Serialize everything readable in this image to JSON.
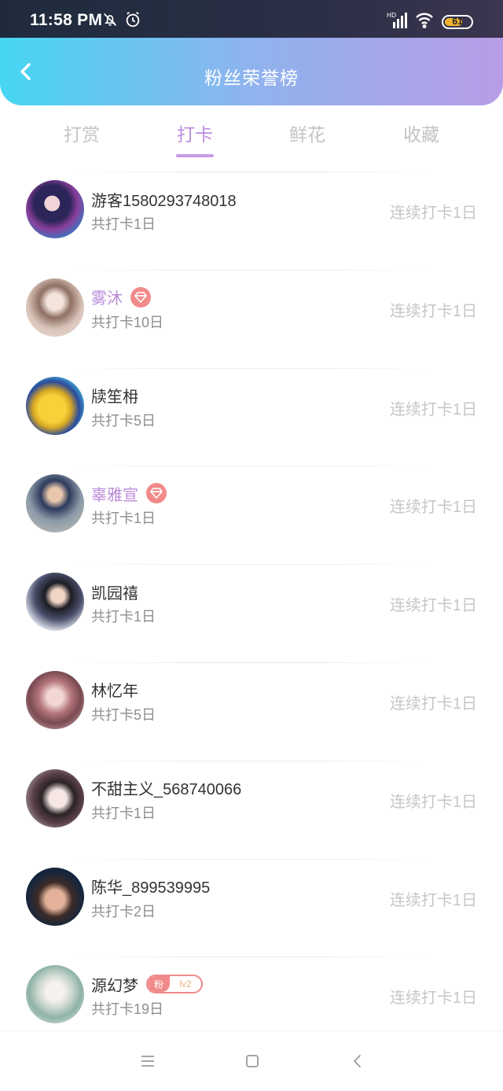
{
  "status_bar": {
    "time": "11:58 PM",
    "battery": "61",
    "icons": [
      "bell-off-icon",
      "alarm-icon",
      "signal-icon",
      "wifi-icon",
      "battery-icon"
    ]
  },
  "header": {
    "title": "粉丝荣誉榜",
    "back_icon": "chevron-left-icon"
  },
  "tabs": [
    {
      "label": "打赏",
      "active": false
    },
    {
      "label": "打卡",
      "active": true
    },
    {
      "label": "鲜花",
      "active": false
    },
    {
      "label": "收藏",
      "active": false
    }
  ],
  "colors": {
    "header_start": "#46d6f3",
    "header_end": "#b89ce6",
    "active_tab": "#bd8ce0",
    "vip_name": "#b98ad8",
    "badge": "#f28a8a"
  },
  "users": [
    {
      "name": "游客1580293748018",
      "total": "共打卡1日",
      "streak": "连续打卡1日",
      "vip": false
    },
    {
      "name": "雾沐",
      "total": "共打卡10日",
      "streak": "连续打卡1日",
      "vip": true
    },
    {
      "name": "牍笙枏",
      "total": "共打卡5日",
      "streak": "连续打卡1日",
      "vip": false
    },
    {
      "name": "辜雅宣",
      "total": "共打卡1日",
      "streak": "连续打卡1日",
      "vip": true
    },
    {
      "name": "凯园禧",
      "total": "共打卡1日",
      "streak": "连续打卡1日",
      "vip": false
    },
    {
      "name": "林忆年",
      "total": "共打卡5日",
      "streak": "连续打卡1日",
      "vip": false
    },
    {
      "name": "不甜主义_568740066",
      "total": "共打卡1日",
      "streak": "连续打卡1日",
      "vip": false
    },
    {
      "name": "陈华_899539995",
      "total": "共打卡2日",
      "streak": "连续打卡1日",
      "vip": false
    },
    {
      "name": "源幻梦",
      "total": "共打卡19日",
      "streak": "连续打卡1日",
      "vip": false,
      "fan_badge": {
        "label": "粉",
        "level": "lv2"
      }
    }
  ],
  "bottom_nav": {
    "icons": [
      "menu-icon",
      "home-icon",
      "back-icon"
    ]
  }
}
